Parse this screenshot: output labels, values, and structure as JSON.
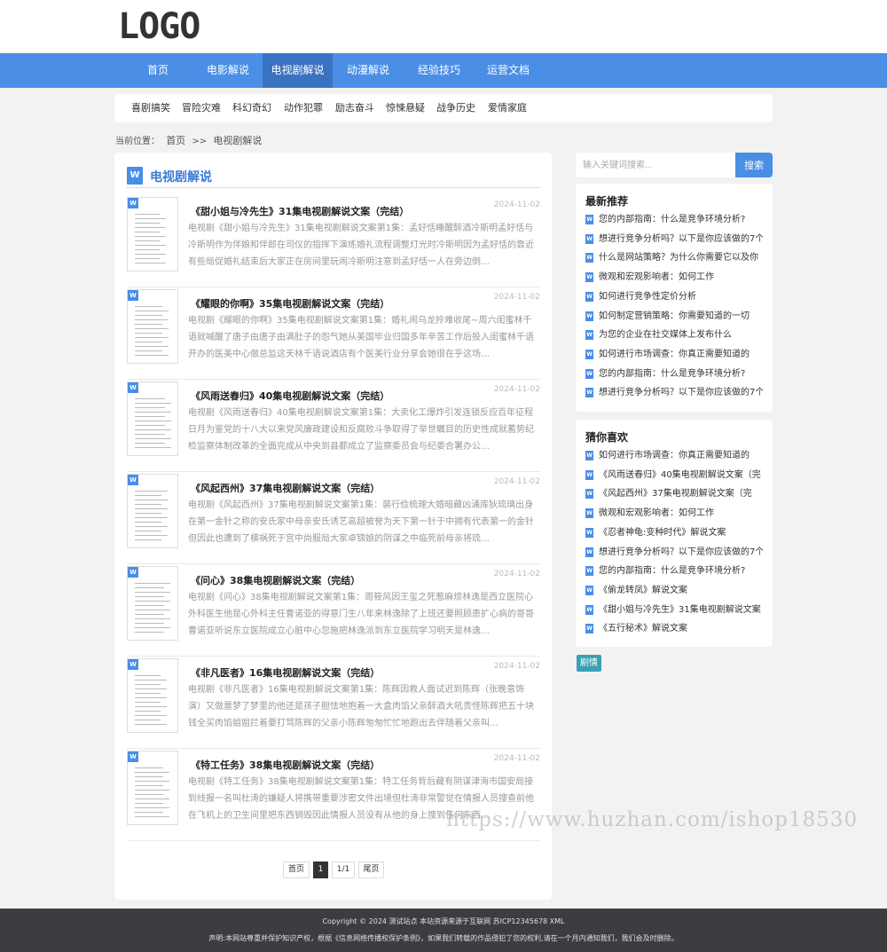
{
  "header": {
    "logo": "LOGO"
  },
  "nav": {
    "items": [
      {
        "label": "首页"
      },
      {
        "label": "电影解说"
      },
      {
        "label": "电视剧解说"
      },
      {
        "label": "动漫解说"
      },
      {
        "label": "经验技巧"
      },
      {
        "label": "运营文档"
      }
    ],
    "active_index": 2
  },
  "subnav": {
    "items": [
      {
        "label": "喜剧搞笑"
      },
      {
        "label": "冒险灾难"
      },
      {
        "label": "科幻奇幻"
      },
      {
        "label": "动作犯罪"
      },
      {
        "label": "励志奋斗"
      },
      {
        "label": "惊悚悬疑"
      },
      {
        "label": "战争历史"
      },
      {
        "label": "爱情家庭"
      }
    ]
  },
  "breadcrumb": {
    "prefix": "当前位置：",
    "home": "首页",
    "sep": ">>",
    "current": "电视剧解说"
  },
  "main": {
    "icon": "word-doc-icon",
    "title": "电视剧解说",
    "articles": [
      {
        "title": "《甜小姐与冷先生》31集电视剧解说文案（完结）",
        "date": "2024-11-02",
        "desc": "电视剧《甜小姐与冷先生》31集电视剧解说文案第1集：孟好恬睡醒醉酒冷斯明孟好恬与冷斯明作为伴娘和伴郎在司仪的指挥下演练婚礼流程调整灯光时冷斯明因为孟好恬的靠近有些局促婚礼结束后大家正在房间里玩闹冷斯明注意到孟好恬一人在旁边倒…"
      },
      {
        "title": "《耀眼的你啊》35集电视剧解说文案（完结）",
        "date": "2024-11-02",
        "desc": "电视剧《耀眼的你啊》35集电视剧解说文案第1集：婚礼闹乌龙拎难收尾~周六闺蜜林千语就喊醒了唐子由唐子由满肚子的怨气她从美国毕业归国多年辛苦工作后投入闺蜜林千语开办的医美中心做总监这天林千语说酒店有个医美行业分享会她很在乎这场…"
      },
      {
        "title": "《风雨送春归》40集电视剧解说文案（完结）",
        "date": "2024-11-02",
        "desc": "电视剧《风雨送春归》40集电视剧解说文案第1集：大卖化工爆炸引发连锁反应百年征程日月为鉴党的十八大以来党风廉政建设和反腐败斗争取得了举世瞩目的历史性成就蓄势纪检监察体制改革的全面完成从中央到县都成立了监察委员会与纪委合署办公…"
      },
      {
        "title": "《风起西州》37集电视剧解说文案（完结）",
        "date": "2024-11-02",
        "desc": "电视剧《风起西州》37集电视剧解说文案第1集：裴行俭梳理大婚暗藏凶涌库狄琉璃出身在第一金针之称的安氏家中母亲安氏诱艺高超被誉为天下第一针于中拥有代表第一的金针但因此也遭到了横祸死于宫中尚服局大家卓锦娘的阴谋之中临死前母亲将琉…"
      },
      {
        "title": "《问心》38集电视剧解说文案（完结）",
        "date": "2024-11-02",
        "desc": "电视剧《问心》38集电视剧解说文案第1集：周筱风因王玺之死惹麻烦林逸是西立医院心外科医生他是心外科主任曹诺亚的得意门生八年来林逸除了上班还要照顾患扩心病的哥哥曹诺亚听说东立医院成立心脏中心忽施把林逸派到东立医院学习明天是林逸…"
      },
      {
        "title": "《非凡医者》16集电视剧解说文案（完结）",
        "date": "2024-11-02",
        "desc": "电视剧《非凡医者》16集电视剧解说文案第1集：陈辉因救人面试迟到陈辉（张晚意饰演）又做噩梦了梦里的他还是孩子胆怯地抱着一大盒肉馅父亲醉酒大吼责怪陈辉把五十块钱全买肉馅姐姐拦着要打骂陈辉的父亲小陈辉匆匆忙忙地跑出去伴随着父亲叫…"
      },
      {
        "title": "《特工任务》38集电视剧解说文案（完结）",
        "date": "2024-11-02",
        "desc": "电视剧《特工任务》38集电视剧解说文案第1集：特工任务背后藏有阴谋津海市国安局接到线报一名叫杜涛的嫌疑人将携带重要涉密文件出境但杜涛非常警觉在情报人员搜查前他在飞机上的卫生间里把东西销毁因此情报人员没有从他的身上搜到任何东西…"
      }
    ]
  },
  "pager": {
    "first": "首页",
    "current": "1",
    "count": "1/1",
    "last": "尾页"
  },
  "search": {
    "placeholder": "输入关键词搜索...",
    "button": "搜索"
  },
  "latest": {
    "title": "最新推荐",
    "items": [
      "您的内部指南：什么是竞争环境分析?",
      "想进行竞争分析吗？以下是你应该做的7个",
      "什么是网站策略？为什么你需要它以及你",
      "微观和宏观影响者：如何工作",
      "如何进行竞争性定价分析",
      "如何制定营销策略：你需要知道的一切",
      "为您的企业在社交媒体上发布什么",
      "如何进行市场调查：你真正需要知道的",
      "您的内部指南：什么是竞争环境分析?",
      "想进行竞争分析吗？以下是你应该做的7个"
    ]
  },
  "guess": {
    "title": "猜你喜欢",
    "items": [
      "如何进行市场调查：你真正需要知道的",
      "《风雨送春归》40集电视剧解说文案（完",
      "《风起西州》37集电视剧解说文案（完",
      "微观和宏观影响者：如何工作",
      "《忍者神龟:变种时代》解说文案",
      "想进行竞争分析吗？以下是你应该做的7个",
      "您的内部指南：什么是竞争环境分析?",
      "《偷龙转凤》解说文案",
      "《甜小姐与冷先生》31集电视剧解说文案",
      "《五行秘术》解说文案"
    ]
  },
  "tag": {
    "label": "剧情"
  },
  "footer": {
    "line1": "Copyright © 2024 测试站点 本站资源来源于互联网  苏ICP12345678  XML",
    "line2": "声明:本网站尊重并保护知识产权，根据《信息网络传播权保护条例》，如果我们转载的作品侵犯了您的权利,请在一个月内通知我们，我们会及时删除。"
  },
  "watermark": {
    "text": "https://www.huzhan.com/ishop18530"
  },
  "colors": {
    "accent": "#4a8ee6",
    "nav_active": "#3a72c2",
    "tag": "#3aa0b4",
    "footer": "#3c3d41"
  }
}
